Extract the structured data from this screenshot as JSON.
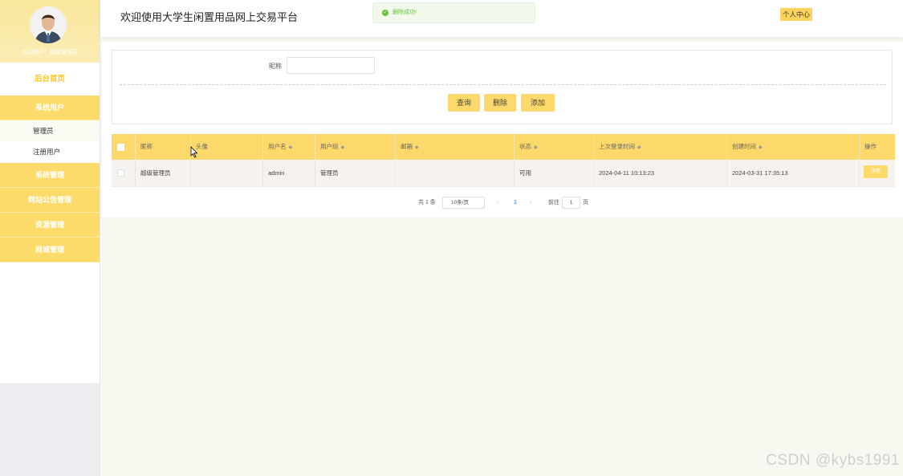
{
  "sidebar": {
    "user_text": "欢迎用户：超级管理员",
    "menu": {
      "home": "后台首页",
      "system_users": "系统用户",
      "admin": "管理员",
      "registered_users": "注册用户",
      "system_management": "系统管理",
      "site_notice": "网站公告管理",
      "resource": "资源管理",
      "mall": "商城管理"
    }
  },
  "header": {
    "title": "欢迎使用大学生闲置用品网上交易平台",
    "toast": "删除成功!",
    "profile_center": "个人中心"
  },
  "search": {
    "nickname_label": "昵称",
    "nickname_value": "",
    "buttons": {
      "query": "查询",
      "delete": "删除",
      "add": "添加"
    }
  },
  "table": {
    "headers": [
      "昵称",
      "头像",
      "用户名",
      "用户组",
      "邮箱",
      "状态",
      "上次登录时间",
      "创建时间",
      "操作"
    ],
    "rows": [
      {
        "nickname": "超级管理员",
        "avatar": "",
        "username": "admin",
        "group": "管理员",
        "email": "",
        "status": "可用",
        "last_login": "2024-04-11 10:13:23",
        "created": "2024-03-31 17:35:13",
        "action": "详情"
      }
    ]
  },
  "pagination": {
    "total": "共 1 条",
    "page_size": "10条/页",
    "current_page": "1",
    "goto_label": "前往",
    "goto_value": "1",
    "page_suffix": "页"
  },
  "watermark": "CSDN @kybs1991",
  "colors": {
    "accent": "#fdd86a",
    "toast_success": "#67c23a"
  }
}
